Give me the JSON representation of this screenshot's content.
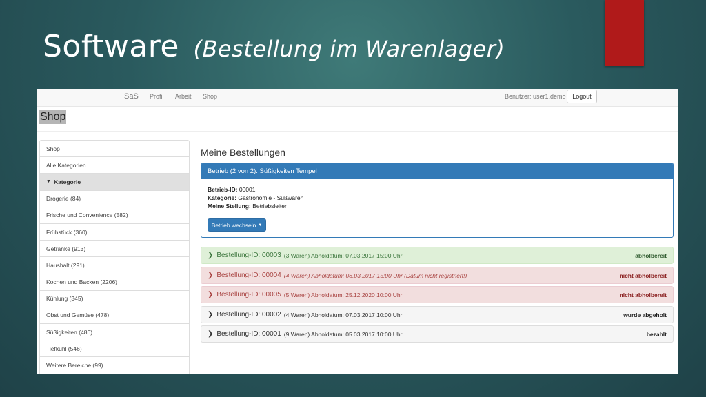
{
  "slide": {
    "title": "Software",
    "subtitle": "(Bestellung im Warenlager)"
  },
  "navbar": {
    "brand": "SaS",
    "links": [
      "Profil",
      "Arbeit",
      "Shop"
    ],
    "user": "Benutzer: user1.demo",
    "logout": "Logout"
  },
  "page": {
    "heading": "Shop"
  },
  "sidebar": {
    "items": [
      {
        "label": "Shop"
      },
      {
        "label": "Alle Kategorien"
      },
      {
        "label": "Kategorie"
      },
      {
        "label": "Drogerie (84)"
      },
      {
        "label": "Frische und Convenience (582)"
      },
      {
        "label": "Frühstück (360)"
      },
      {
        "label": "Getränke (913)"
      },
      {
        "label": "Haushalt (291)"
      },
      {
        "label": "Kochen und Backen (2206)"
      },
      {
        "label": "Kühlung (345)"
      },
      {
        "label": "Obst und Gemüse (478)"
      },
      {
        "label": "Süßigkeiten (486)"
      },
      {
        "label": "Tiefkühl (546)"
      },
      {
        "label": "Weitere Bereiche (99)"
      }
    ]
  },
  "main": {
    "title": "Meine Bestellungen",
    "business": {
      "header": "Betrieb (2 von 2): Süßigkeiten Tempel",
      "id_label": "Betrieb-ID:",
      "id_value": "00001",
      "category_label": "Kategorie:",
      "category_value": "Gastronomie - Süßwaren",
      "position_label": "Meine Stellung:",
      "position_value": "Betriebsleiter",
      "switch_button": "Betrieb wechseln"
    },
    "orders": [
      {
        "id": "Bestellung-ID: 00003",
        "details": "(3 Waren) Abholdatum: 07.03.2017 15:00 Uhr",
        "status": "abholbereit",
        "variant": "green"
      },
      {
        "id": "Bestellung-ID: 00004",
        "details": "(4 Waren) Abholdatum: 08.03.2017 15:00 Uhr (Datum nicht registriert!)",
        "status": "nicht abholbereit",
        "variant": "red"
      },
      {
        "id": "Bestellung-ID: 00005",
        "details": "(5 Waren) Abholdatum: 25.12.2020 10:00 Uhr",
        "status": "nicht abholbereit",
        "variant": "red"
      },
      {
        "id": "Bestellung-ID: 00002",
        "details": "(4 Waren) Abholdatum: 07.03.2017 10:00 Uhr",
        "status": "wurde abgeholt",
        "variant": "gray"
      },
      {
        "id": "Bestellung-ID: 00001",
        "details": "(9 Waren) Abholdatum: 05.03.2017 10:00 Uhr",
        "status": "bezahlt",
        "variant": "gray"
      }
    ]
  },
  "colors": {
    "primary": "#337ab7",
    "success_bg": "#dff0d8",
    "danger_bg": "#f2dede",
    "accent_red": "#b01a1a"
  },
  "icons": {
    "order_expand": "chevron-right-icon",
    "category_toggle": "chevron-down-icon",
    "dropdown": "caret-down-icon"
  }
}
